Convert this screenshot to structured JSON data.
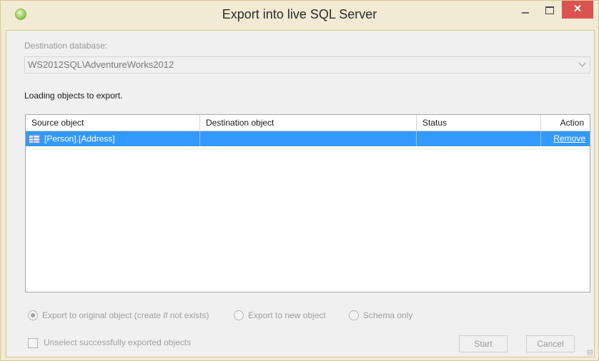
{
  "window": {
    "title": "Export into live SQL Server",
    "controls": {
      "minimize": "–",
      "maximize": "□",
      "close": "✕"
    }
  },
  "destination": {
    "label": "Destination database:",
    "value": "WS2012SQL\\AdventureWorks2012"
  },
  "status_text": "Loading objects to export.",
  "grid": {
    "columns": [
      "Source object",
      "Destination object",
      "Status",
      "Action"
    ],
    "rows": [
      {
        "source": "[Person].[Address]",
        "destination": "",
        "status": "",
        "action": "Remove",
        "selected": true
      }
    ]
  },
  "options": {
    "export_original": "Export to original object (create if not exists)",
    "export_new": "Export to new object",
    "schema_only": "Schema only",
    "selected": "export_original"
  },
  "unselect_label": "Unselect successfully exported objects",
  "buttons": {
    "start": "Start",
    "cancel": "Cancel"
  },
  "colors": {
    "selection": "#3399ff",
    "close_button": "#d9534f",
    "frame": "#f2ead4"
  },
  "icons": {
    "app": "app-icon",
    "row": "table-icon"
  }
}
